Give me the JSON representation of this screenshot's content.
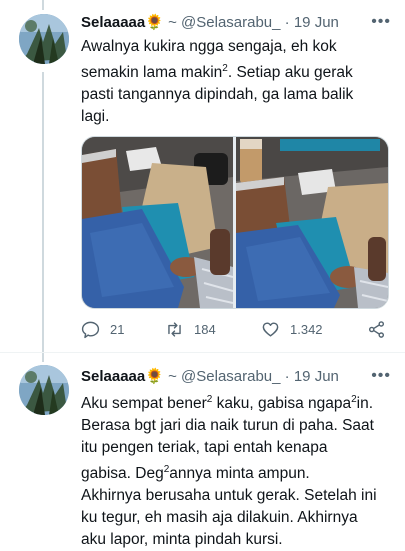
{
  "tweets": [
    {
      "name": "Selaaaaa",
      "name_emoji": "🌻",
      "separator": "~",
      "handle": "@Selasarabu_",
      "dot": "·",
      "date": "19 Jun",
      "more": "•••",
      "lines": [
        "Awalnya kukira ngga sengaja, eh kok",
        "semakin lama makin",
        "2",
        ". Setiap aku gerak",
        "pasti tangannya dipindah, ga lama balik",
        "lagi."
      ],
      "replies": "21",
      "retweets": "184",
      "likes": "1.342"
    },
    {
      "name": "Selaaaaa",
      "name_emoji": "🌻",
      "separator": "~",
      "handle": "@Selasarabu_",
      "dot": "·",
      "date": "19 Jun",
      "more": "•••",
      "lines": [
        "Aku sempat bener",
        "2",
        " kaku, gabisa ngapa",
        "2",
        "in.",
        "Berasa bgt jari dia naik turun di paha. Saat",
        "itu pengen teriak, tapi entah kenapa",
        "gabisa. Deg",
        "2",
        "annya minta ampun.",
        "Akhirnya berusaha untuk gerak. Setelah ini",
        "ku tegur, eh masih aja dilakuin. Akhirnya",
        "aku lapor, minta pindah kursi."
      ]
    }
  ],
  "icons": {
    "reply": "reply-icon",
    "retweet": "retweet-icon",
    "like": "heart-icon",
    "share": "share-icon",
    "more": "more-icon"
  },
  "colors": {
    "text": "#0f1419",
    "secondary": "#536471",
    "thread_line": "#cfd9de"
  }
}
